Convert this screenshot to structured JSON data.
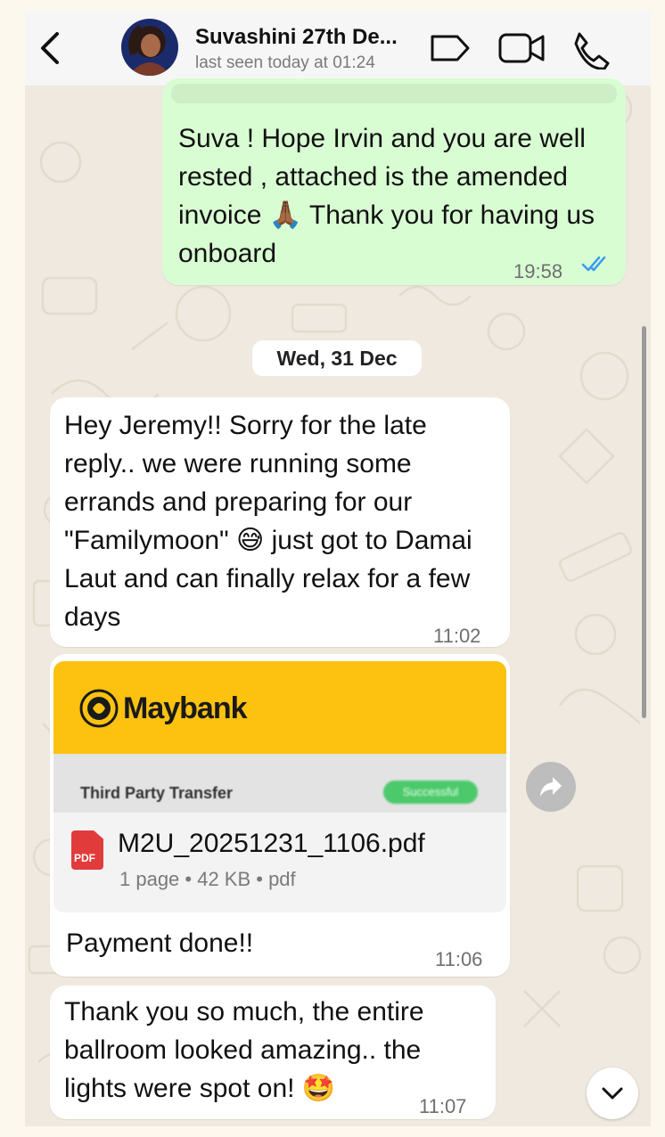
{
  "header": {
    "contact_name": "Suvashini 27th De...",
    "last_seen": "last seen today at 01:24"
  },
  "messages": {
    "m1": {
      "text": "Suva ! Hope Irvin and you are well rested , attached is the amended invoice 🙏🏾 Thank you for having us onboard",
      "time": "19:58"
    },
    "date_chip": "Wed, 31 Dec",
    "m2": {
      "text": "Hey Jeremy!! Sorry for the late reply.. we were running some errands and preparing for our \"Familymoon\" 😅 just got to Damai Laut and can finally relax for a few days",
      "time": "11:02"
    },
    "m3": {
      "preview_brand": "Maybank",
      "preview_caption": "Third Party Transfer",
      "preview_badge": "Successful",
      "file_name": "M2U_20251231_1106.pdf",
      "file_meta": "1 page • 42 KB • pdf",
      "pdf_label": "PDF",
      "caption": "Payment done!!",
      "time": "11:06"
    },
    "m4": {
      "text": "Thank you so much, the entire ballroom looked amazing.. the lights were spot on! 🤩",
      "time": "11:07"
    }
  },
  "icons": {
    "back": "chevron-left-icon",
    "tag": "label-icon",
    "video": "video-camera-icon",
    "call": "phone-icon",
    "read": "double-check-icon",
    "forward": "forward-icon",
    "scroll_down": "chevron-down-icon"
  },
  "colors": {
    "outgoing_bubble": "#d9fdd3",
    "incoming_bubble": "#ffffff",
    "read_ticks": "#3a9cf0",
    "maybank_yellow": "#fcc20f",
    "pdf_red": "#e23b3b",
    "success_green": "#4cc96a"
  }
}
